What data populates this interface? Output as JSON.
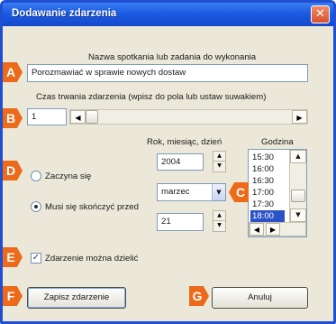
{
  "window": {
    "title": "Dodawanie zdarzenia",
    "close_glyph": "✕"
  },
  "task_name": {
    "label": "Nazwa spotkania lub zadania do wykonania",
    "value": "Porozmawiać w sprawie nowych dostaw"
  },
  "duration": {
    "label": "Czas trwania zdarzenia (wpisz do pola lub ustaw suwakiem)",
    "value": "1",
    "slider_fraction": 0.0
  },
  "date": {
    "label": "Rok, miesiąc, dzień",
    "year": "2004",
    "month": "marzec",
    "day": "21"
  },
  "time": {
    "label": "Godzina",
    "options": [
      "15:30",
      "16:00",
      "16:30",
      "17:00",
      "17:30",
      "18:00"
    ],
    "selected": "18:00"
  },
  "mode": {
    "start_label": "Zaczyna się",
    "end_label": "Musi się skończyć przed",
    "selected": "end"
  },
  "divisible": {
    "label": "Zdarzenie można dzielić",
    "checked": true
  },
  "buttons": {
    "save": "Zapisz zdarzenie",
    "cancel": "Anuluj"
  },
  "badges": {
    "a": "A",
    "b": "B",
    "c": "C",
    "d": "D",
    "e": "E",
    "f": "F",
    "g": "G"
  },
  "icons": {
    "left_arrow": "◀",
    "right_arrow": "▶",
    "up_arrow": "▲",
    "down_arrow": "▼",
    "check": "✓"
  },
  "colors": {
    "badge": "#ec6a1a",
    "titlebar": "#1c5be0",
    "selection": "#2b52c8"
  }
}
